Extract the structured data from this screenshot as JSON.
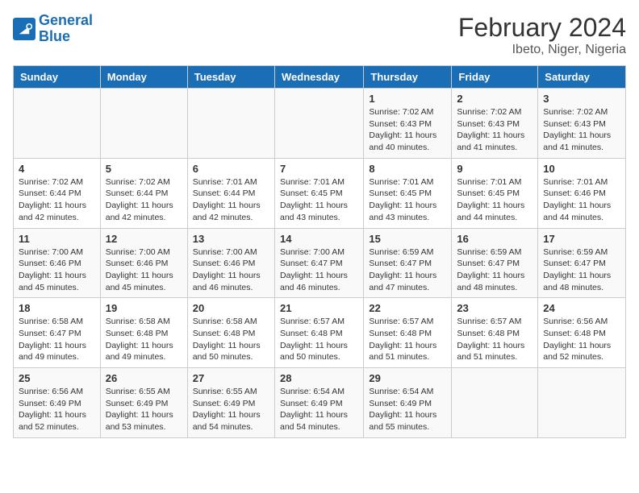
{
  "header": {
    "logo_line1": "General",
    "logo_line2": "Blue",
    "title": "February 2024",
    "subtitle": "Ibeto, Niger, Nigeria"
  },
  "columns": [
    "Sunday",
    "Monday",
    "Tuesday",
    "Wednesday",
    "Thursday",
    "Friday",
    "Saturday"
  ],
  "weeks": [
    [
      {
        "day": "",
        "info": ""
      },
      {
        "day": "",
        "info": ""
      },
      {
        "day": "",
        "info": ""
      },
      {
        "day": "",
        "info": ""
      },
      {
        "day": "1",
        "info": "Sunrise: 7:02 AM\nSunset: 6:43 PM\nDaylight: 11 hours and 40 minutes."
      },
      {
        "day": "2",
        "info": "Sunrise: 7:02 AM\nSunset: 6:43 PM\nDaylight: 11 hours and 41 minutes."
      },
      {
        "day": "3",
        "info": "Sunrise: 7:02 AM\nSunset: 6:43 PM\nDaylight: 11 hours and 41 minutes."
      }
    ],
    [
      {
        "day": "4",
        "info": "Sunrise: 7:02 AM\nSunset: 6:44 PM\nDaylight: 11 hours and 42 minutes."
      },
      {
        "day": "5",
        "info": "Sunrise: 7:02 AM\nSunset: 6:44 PM\nDaylight: 11 hours and 42 minutes."
      },
      {
        "day": "6",
        "info": "Sunrise: 7:01 AM\nSunset: 6:44 PM\nDaylight: 11 hours and 42 minutes."
      },
      {
        "day": "7",
        "info": "Sunrise: 7:01 AM\nSunset: 6:45 PM\nDaylight: 11 hours and 43 minutes."
      },
      {
        "day": "8",
        "info": "Sunrise: 7:01 AM\nSunset: 6:45 PM\nDaylight: 11 hours and 43 minutes."
      },
      {
        "day": "9",
        "info": "Sunrise: 7:01 AM\nSunset: 6:45 PM\nDaylight: 11 hours and 44 minutes."
      },
      {
        "day": "10",
        "info": "Sunrise: 7:01 AM\nSunset: 6:46 PM\nDaylight: 11 hours and 44 minutes."
      }
    ],
    [
      {
        "day": "11",
        "info": "Sunrise: 7:00 AM\nSunset: 6:46 PM\nDaylight: 11 hours and 45 minutes."
      },
      {
        "day": "12",
        "info": "Sunrise: 7:00 AM\nSunset: 6:46 PM\nDaylight: 11 hours and 45 minutes."
      },
      {
        "day": "13",
        "info": "Sunrise: 7:00 AM\nSunset: 6:46 PM\nDaylight: 11 hours and 46 minutes."
      },
      {
        "day": "14",
        "info": "Sunrise: 7:00 AM\nSunset: 6:47 PM\nDaylight: 11 hours and 46 minutes."
      },
      {
        "day": "15",
        "info": "Sunrise: 6:59 AM\nSunset: 6:47 PM\nDaylight: 11 hours and 47 minutes."
      },
      {
        "day": "16",
        "info": "Sunrise: 6:59 AM\nSunset: 6:47 PM\nDaylight: 11 hours and 48 minutes."
      },
      {
        "day": "17",
        "info": "Sunrise: 6:59 AM\nSunset: 6:47 PM\nDaylight: 11 hours and 48 minutes."
      }
    ],
    [
      {
        "day": "18",
        "info": "Sunrise: 6:58 AM\nSunset: 6:47 PM\nDaylight: 11 hours and 49 minutes."
      },
      {
        "day": "19",
        "info": "Sunrise: 6:58 AM\nSunset: 6:48 PM\nDaylight: 11 hours and 49 minutes."
      },
      {
        "day": "20",
        "info": "Sunrise: 6:58 AM\nSunset: 6:48 PM\nDaylight: 11 hours and 50 minutes."
      },
      {
        "day": "21",
        "info": "Sunrise: 6:57 AM\nSunset: 6:48 PM\nDaylight: 11 hours and 50 minutes."
      },
      {
        "day": "22",
        "info": "Sunrise: 6:57 AM\nSunset: 6:48 PM\nDaylight: 11 hours and 51 minutes."
      },
      {
        "day": "23",
        "info": "Sunrise: 6:57 AM\nSunset: 6:48 PM\nDaylight: 11 hours and 51 minutes."
      },
      {
        "day": "24",
        "info": "Sunrise: 6:56 AM\nSunset: 6:48 PM\nDaylight: 11 hours and 52 minutes."
      }
    ],
    [
      {
        "day": "25",
        "info": "Sunrise: 6:56 AM\nSunset: 6:49 PM\nDaylight: 11 hours and 52 minutes."
      },
      {
        "day": "26",
        "info": "Sunrise: 6:55 AM\nSunset: 6:49 PM\nDaylight: 11 hours and 53 minutes."
      },
      {
        "day": "27",
        "info": "Sunrise: 6:55 AM\nSunset: 6:49 PM\nDaylight: 11 hours and 54 minutes."
      },
      {
        "day": "28",
        "info": "Sunrise: 6:54 AM\nSunset: 6:49 PM\nDaylight: 11 hours and 54 minutes."
      },
      {
        "day": "29",
        "info": "Sunrise: 6:54 AM\nSunset: 6:49 PM\nDaylight: 11 hours and 55 minutes."
      },
      {
        "day": "",
        "info": ""
      },
      {
        "day": "",
        "info": ""
      }
    ]
  ]
}
